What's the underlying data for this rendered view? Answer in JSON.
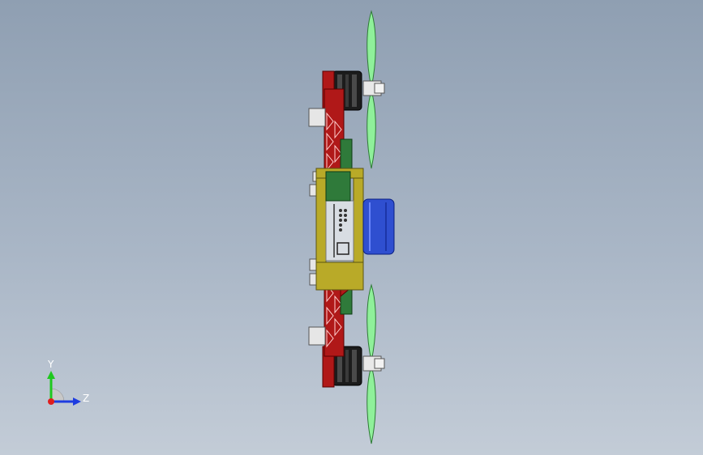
{
  "triad": {
    "y_label": "Y",
    "z_label": "Z"
  },
  "colors": {
    "background_top": "#8f9fb2",
    "background_bottom": "#c3ccd7",
    "frame_red": "#b01818",
    "arm_yellow": "#b9aa28",
    "propeller_green": "#7fe08a",
    "motor_black": "#1c1c1c",
    "battery_blue": "#2f4fd0",
    "board_green": "#2f7a3a",
    "axis_y": "#1ec81e",
    "axis_z": "#1e3ce0",
    "axis_origin": "#e01e1e"
  }
}
